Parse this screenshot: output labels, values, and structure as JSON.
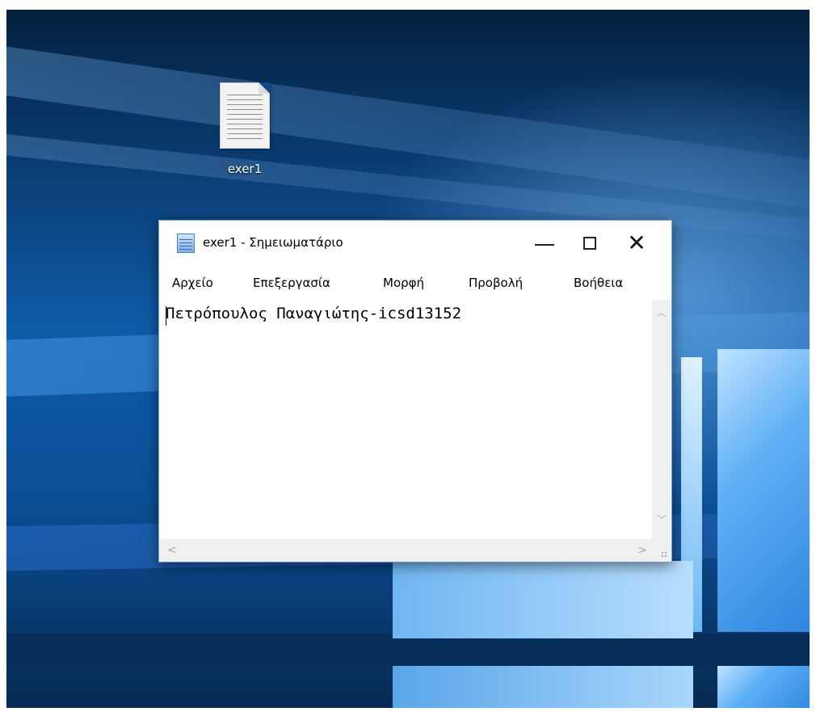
{
  "desktop": {
    "icons": [
      {
        "label": "exer1",
        "icon": "text-file-icon"
      }
    ],
    "wallpaper_icon": "windows-logo"
  },
  "notepad": {
    "title": "exer1 - Σημειωματάριο",
    "app_icon": "notepad-icon",
    "caption_buttons": {
      "minimize": "minimize-icon",
      "maximize": "maximize-icon",
      "close_glyph": "✕"
    },
    "menu": {
      "file": "Αρχείο",
      "edit": "Επεξεργασία",
      "format": "Μορφή",
      "view": "Προβολή",
      "help": "Βοήθεια"
    },
    "content": "Πετρόπουλος Παναγιώτης-icsd13152",
    "scroll_glyphs": {
      "up": "︿",
      "down": "﹀",
      "left": "<",
      "right": ">"
    }
  },
  "colors": {
    "desktop_base": "#0f5aa6",
    "window_border": "#7a9dc7",
    "scrollbar": "#f0f0f0"
  }
}
